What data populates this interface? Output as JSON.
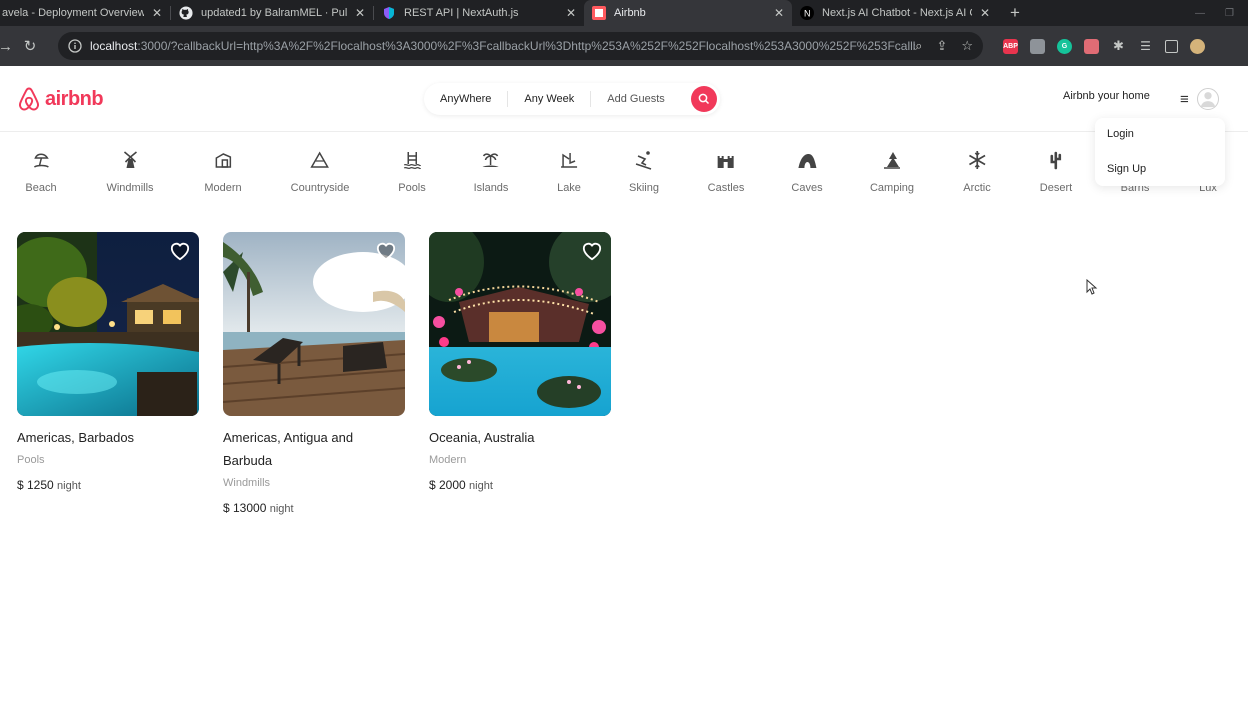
{
  "browser": {
    "tabs": [
      {
        "label": "avela - Deployment Overview",
        "active": false
      },
      {
        "label": "updated1 by BalramMEL · Pull Re",
        "active": false
      },
      {
        "label": "REST API | NextAuth.js",
        "active": false
      },
      {
        "label": "Airbnb",
        "active": true
      },
      {
        "label": "Next.js AI Chatbot - Next.js AI Ch",
        "active": false
      }
    ],
    "url_host": "localhost",
    "url_rest": ":3000/?callbackUrl=http%3A%2F%2Flocalhost%3A3000%2F%3FcallbackUrl%3Dhttp%253A%252F%252Flocalhost%253A3000%252F%253FcallbackUrl..."
  },
  "header": {
    "logo": "airbnb",
    "search": {
      "where": "AnyWhere",
      "week": "Any Week",
      "guests": "Add Guests"
    },
    "host_link": "Airbnb your home"
  },
  "menu": {
    "login": "Login",
    "signup": "Sign Up"
  },
  "categories": [
    {
      "label": "Beach",
      "icon": "beach-icon"
    },
    {
      "label": "Windmills",
      "icon": "windmill-icon"
    },
    {
      "label": "Modern",
      "icon": "modern-icon"
    },
    {
      "label": "Countryside",
      "icon": "mountain-icon"
    },
    {
      "label": "Pools",
      "icon": "pool-icon"
    },
    {
      "label": "Islands",
      "icon": "island-icon"
    },
    {
      "label": "Lake",
      "icon": "lake-icon"
    },
    {
      "label": "Skiing",
      "icon": "skiing-icon"
    },
    {
      "label": "Castles",
      "icon": "castle-icon"
    },
    {
      "label": "Caves",
      "icon": "cave-icon"
    },
    {
      "label": "Camping",
      "icon": "camping-icon"
    },
    {
      "label": "Arctic",
      "icon": "snowflake-icon"
    },
    {
      "label": "Desert",
      "icon": "cactus-icon"
    },
    {
      "label": "Barns",
      "icon": "barn-icon"
    },
    {
      "label": "Lux",
      "icon": "diamond-icon"
    }
  ],
  "listings": [
    {
      "title": "Americas, Barbados",
      "category": "Pools",
      "price": "$ 1250",
      "unit": "night"
    },
    {
      "title": "Americas, Antigua and Barbuda",
      "category": "Windmills",
      "price": "$ 13000",
      "unit": "night"
    },
    {
      "title": "Oceania, Australia",
      "category": "Modern",
      "price": "$ 2000",
      "unit": "night"
    }
  ],
  "colors": {
    "brand": "#f1395a",
    "muted_text": "#9a9a9a"
  }
}
